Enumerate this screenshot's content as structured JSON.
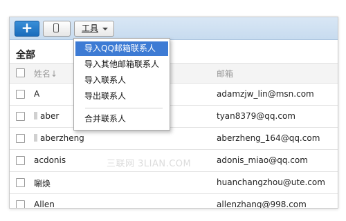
{
  "toolbar": {
    "add_label": "+",
    "tools_label": "工具"
  },
  "heading": "全部",
  "table": {
    "columns": {
      "name": "姓名↓",
      "email": "邮箱"
    },
    "rows": [
      {
        "name": "A",
        "email": "adamzjw_lin@msn.com",
        "flag": false
      },
      {
        "name": "aber",
        "email": "tyan8379@qq.com",
        "flag": true
      },
      {
        "name": "aberzheng",
        "email": "aberzheng_164@qq.com",
        "flag": true
      },
      {
        "name": "acdonis",
        "email": "adonis_miao@qq.com",
        "flag": false
      },
      {
        "name": "唰焕",
        "email": "huanchangzhou@ute.com",
        "flag": false
      },
      {
        "name": "Allen",
        "email": "allenzhang@998.com",
        "flag": false
      }
    ]
  },
  "menu": {
    "items": [
      {
        "label": "导入QQ邮箱联系人"
      },
      {
        "label": "导入其他邮箱联系人"
      },
      {
        "label": "导入联系人"
      },
      {
        "label": "导出联系人"
      },
      {
        "label": "合并联系人"
      }
    ]
  },
  "watermark": "三联网 3LIAN.COM",
  "colors": {
    "accent": "#3d7bd4",
    "toolbar_bg": "#d0e2f3",
    "add_button": "#1f73c2"
  }
}
